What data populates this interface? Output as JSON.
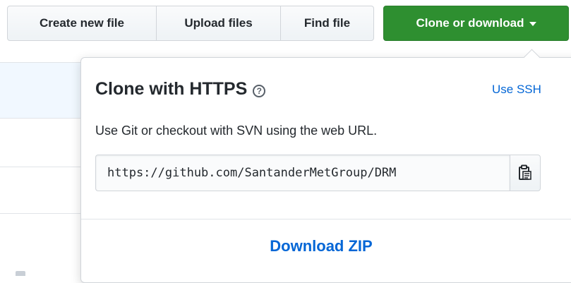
{
  "toolbar": {
    "create_new_file": "Create new file",
    "upload_files": "Upload files",
    "find_file": "Find file",
    "clone_or_download": "Clone or download"
  },
  "clone_dropdown": {
    "title": "Clone with HTTPS",
    "help_symbol": "?",
    "use_ssh": "Use SSH",
    "description": "Use Git or checkout with SVN using the web URL.",
    "clone_url": "https://github.com/SantanderMetGroup/DRM",
    "copy_icon": "clipboard-icon",
    "download_zip": "Download ZIP"
  },
  "colors": {
    "primary_green": "#2e8f30",
    "link_blue": "#0366d6",
    "row_highlight": "#f1f8ff"
  }
}
